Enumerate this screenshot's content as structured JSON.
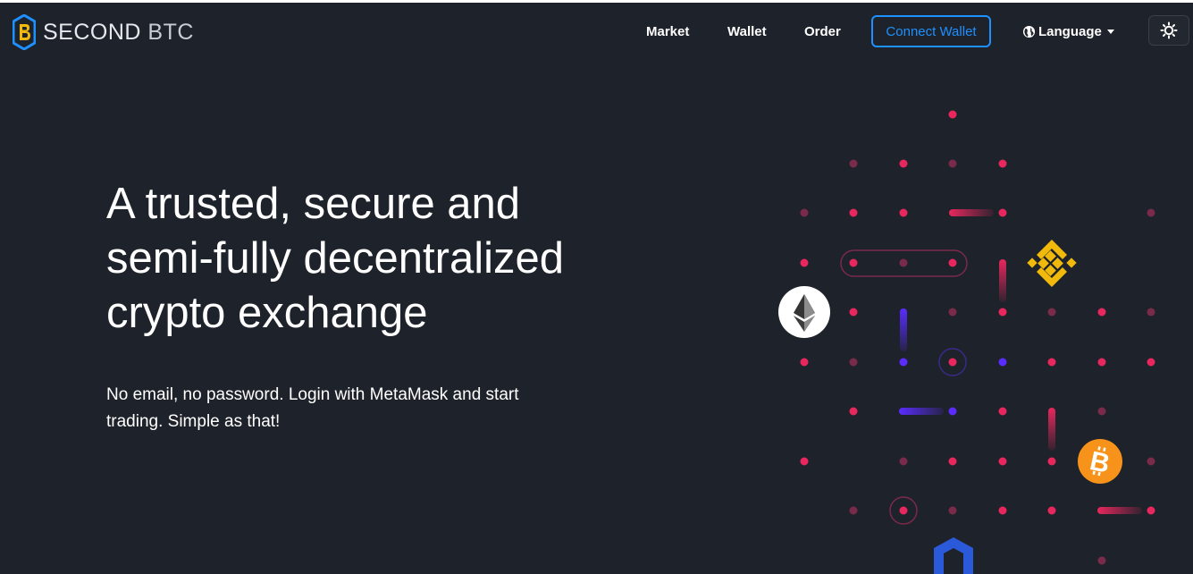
{
  "brand": {
    "name_bold": "SECOND",
    "name_light": "BTC"
  },
  "nav": {
    "market": "Market",
    "wallet": "Wallet",
    "order": "Order",
    "connect_wallet": "Connect Wallet",
    "language": "Language"
  },
  "hero": {
    "title_lines": [
      "A trusted, secure and",
      "semi-fully decentralized",
      "crypto exchange"
    ],
    "subtitle_lines": [
      "No email, no password. Login with MetaMask and start",
      "trading. Simple as that!"
    ]
  },
  "colors": {
    "background": "#1e222a",
    "accent_blue": "#1e90ff",
    "dot_pink": "#e8275e",
    "dot_dim": "#7a2a4a",
    "dot_purple": "#5a2cff",
    "binance": "#f0b90b",
    "bitcoin": "#f7931a",
    "chainlink": "#2a5ada"
  },
  "icons": [
    "logo-icon",
    "globe-icon",
    "caret-down-icon",
    "sun-icon",
    "ethereum-icon",
    "binance-icon",
    "bitcoin-icon",
    "chainlink-icon"
  ]
}
